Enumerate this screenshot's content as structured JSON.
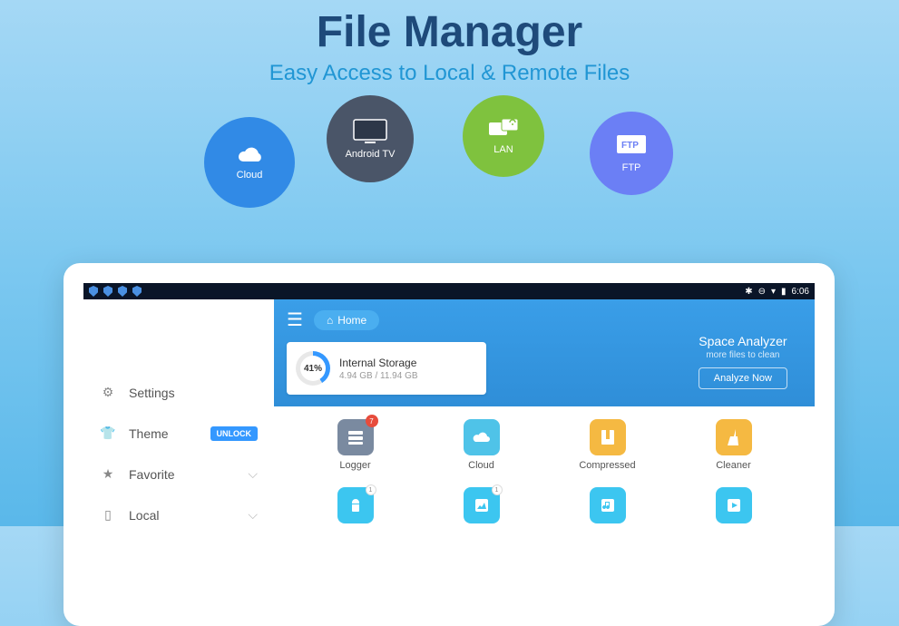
{
  "promo": {
    "title": "File Manager",
    "subtitle": "Easy Access to Local & Remote Files"
  },
  "bubbles": {
    "cloud": "Cloud",
    "tv": "Android TV",
    "lan": "LAN",
    "ftp": "FTP"
  },
  "statusbar": {
    "time": "6:06"
  },
  "sidebar": {
    "settings": "Settings",
    "theme": "Theme",
    "unlock": "UNLOCK",
    "favorite": "Favorite",
    "local": "Local"
  },
  "header": {
    "home": "Home",
    "storage": {
      "title": "Internal Storage",
      "percent": "41%",
      "sub": "4.94 GB / 11.94 GB"
    },
    "analyzer": {
      "title": "Space Analyzer",
      "sub": "more files to clean",
      "btn": "Analyze Now"
    }
  },
  "grid": {
    "logger": {
      "label": "Logger",
      "badge": "7",
      "color": "#7a8aa0"
    },
    "cloud": {
      "label": "Cloud",
      "color": "#4fc3e8"
    },
    "compressed": {
      "label": "Compressed",
      "color": "#f5b942"
    },
    "cleaner": {
      "label": "Cleaner",
      "color": "#f5b942"
    },
    "apps": {
      "badge": "1",
      "color": "#3cc6f0"
    },
    "images": {
      "badge": "1",
      "color": "#3cc6f0"
    },
    "music": {
      "color": "#3cc6f0"
    },
    "videos": {
      "color": "#3cc6f0"
    }
  }
}
